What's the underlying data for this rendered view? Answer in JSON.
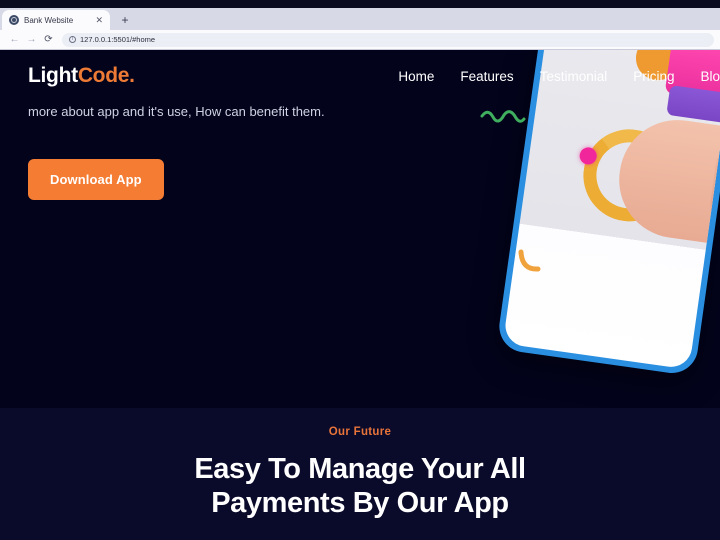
{
  "browser": {
    "tab": {
      "title": "Bank Website",
      "favicon_icon": "globe-icon",
      "close_label": "✕"
    },
    "new_tab_label": "+",
    "back_label": "←",
    "forward_label": "→",
    "reload_label": "⟳",
    "site_info_label": "ⓘ",
    "url": "127.0.0.1:5501/#home"
  },
  "site": {
    "logo": {
      "part1": "Light",
      "part2": "Code.",
      "accent": "#ee7b35"
    },
    "nav": [
      {
        "label": "Home"
      },
      {
        "label": "Features"
      },
      {
        "label": "Testimonial"
      },
      {
        "label": "Pricing"
      },
      {
        "label": "Blo"
      }
    ],
    "hero": {
      "paragraph": "more about app and it's use, How can benefit them.",
      "cta_label": "Download App",
      "cta_color": "#f47c33",
      "background": "#03031c"
    },
    "future": {
      "eyebrow": "Our Future",
      "title_line1": "Easy To Manage Your All",
      "title_line2": "Payments By Our App",
      "background": "#0a0a2a",
      "eyebrow_color": "#e8743a"
    }
  }
}
